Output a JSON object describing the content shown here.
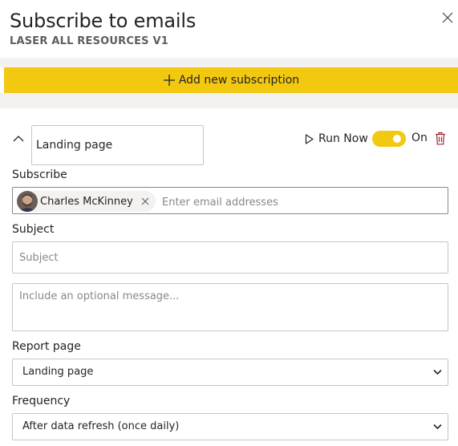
{
  "header": {
    "title": "Subscribe to emails",
    "subtitle": "LASER ALL RESOURCES V1"
  },
  "add_subscription": {
    "label": "Add new subscription"
  },
  "subscription": {
    "name_value": "Landing page",
    "run_now_label": "Run Now",
    "enabled": true,
    "toggle_label": "On",
    "subscribe": {
      "label": "Subscribe",
      "recipients": [
        {
          "name": "Charles McKinney"
        }
      ],
      "placeholder": "Enter email addresses"
    },
    "subject": {
      "label": "Subject",
      "placeholder": "Subject"
    },
    "message": {
      "placeholder": "Include an optional message..."
    },
    "report_page": {
      "label": "Report page",
      "value": "Landing page"
    },
    "frequency": {
      "label": "Frequency",
      "value": "After data refresh (once daily)"
    }
  },
  "colors": {
    "accent": "#f2c811",
    "panel_gray": "#f3f2f1",
    "text": "#252423"
  },
  "icons": {
    "close": "close-icon",
    "add": "plus-icon",
    "collapse": "chevron-up-icon",
    "run": "play-icon",
    "delete": "trash-icon",
    "remove_recipient": "close-icon",
    "dropdown": "chevron-down-icon"
  }
}
